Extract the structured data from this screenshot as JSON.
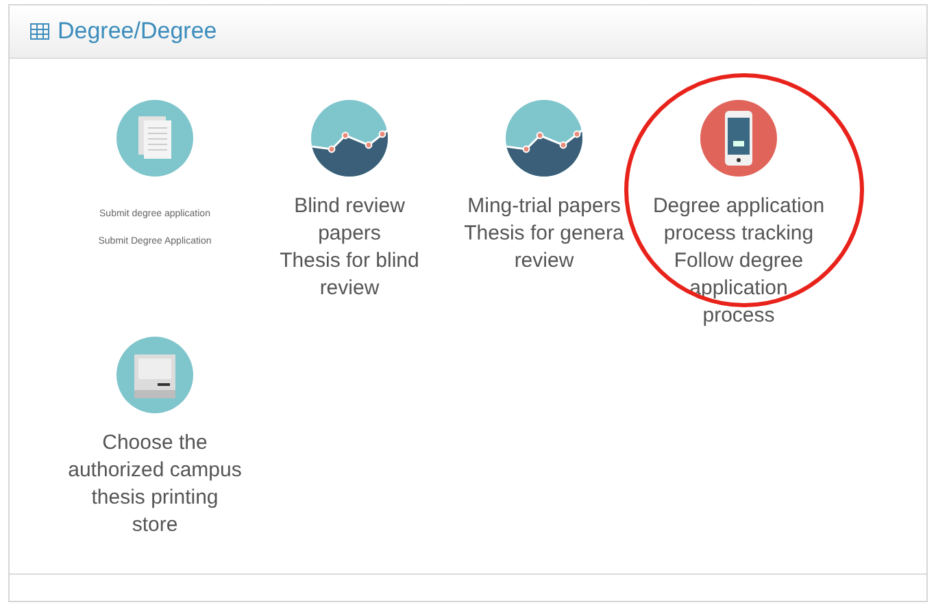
{
  "panel": {
    "title": "Degree/Degree"
  },
  "items": [
    {
      "kind": "document",
      "lines": [
        "Submit degree application",
        "Submit Degree Application"
      ],
      "highlighted": false
    },
    {
      "kind": "chart",
      "lines": [
        "Blind review",
        "papers",
        "Thesis for blind",
        "review"
      ],
      "highlighted": false
    },
    {
      "kind": "chart",
      "lines": [
        "Ming-trial papers",
        "Thesis for genera",
        "review"
      ],
      "highlighted": false
    },
    {
      "kind": "phone",
      "lines": [
        "Degree application",
        "process tracking",
        "Follow degree",
        "application",
        "process"
      ],
      "highlighted": true
    },
    {
      "kind": "printer",
      "lines": [
        "Choose the",
        "authorized campus",
        "thesis printing",
        "store"
      ],
      "highlighted": false
    }
  ]
}
